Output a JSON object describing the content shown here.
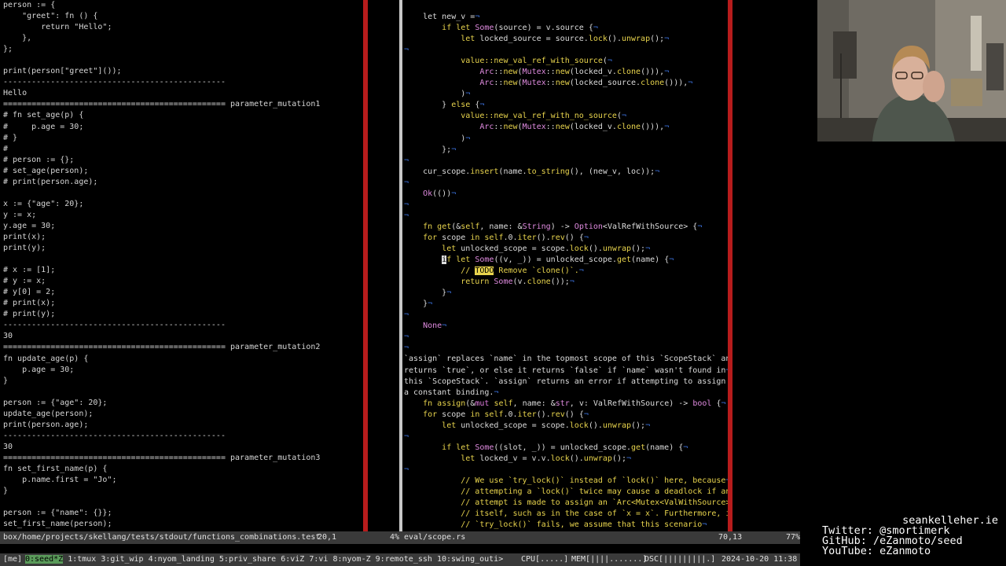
{
  "left_pane": {
    "lines": [
      "person := {",
      "    \"greet\": fn () {",
      "        return \"Hello\";",
      "    },",
      "};",
      "",
      "print(person[\"greet\"]());",
      "-----------------------------------------------",
      "Hello",
      "=============================================== parameter_mutation1",
      "# fn set_age(p) {",
      "#     p.age = 30;",
      "# }",
      "#",
      "# person := {};",
      "# set_age(person);",
      "# print(person.age);",
      "",
      "x := {\"age\": 20};",
      "y := x;",
      "y.age = 30;",
      "print(x);",
      "print(y);",
      "",
      "# x := [1];",
      "# y := x;",
      "# y[0] = 2;",
      "# print(x);",
      "# print(y);",
      "-----------------------------------------------",
      "30",
      "=============================================== parameter_mutation2",
      "fn update_age(p) {",
      "    p.age = 30;",
      "}",
      "",
      "person := {\"age\": 20};",
      "update_age(person);",
      "print(person.age);",
      "-----------------------------------------------",
      "30",
      "=============================================== parameter_mutation3",
      "fn set_first_name(p) {",
      "    p.name.first = \"Jo\";",
      "}",
      "",
      "person := {\"name\": {}};",
      "set_first_name(person);"
    ]
  },
  "right_pane": {
    "eol": "¬",
    "todo": "TODO",
    "cursor_char": "i",
    "segments": [
      [
        [
          "    let new_v =",
          ""
        ]
      ],
      [
        [
          "        ",
          ""
        ],
        [
          "if let",
          "kw"
        ],
        [
          " ",
          ""
        ],
        [
          "Some",
          "ty"
        ],
        [
          "(source) = v.source {",
          ""
        ]
      ],
      [
        [
          "            ",
          ""
        ],
        [
          "let",
          "kw"
        ],
        [
          " locked_source = source.",
          ""
        ],
        [
          "lock",
          "fnc"
        ],
        [
          "().",
          ""
        ],
        [
          "unwrap",
          "fnc"
        ],
        [
          "();",
          ""
        ]
      ],
      [
        [
          "",
          ""
        ]
      ],
      [
        [
          "            ",
          ""
        ],
        [
          "value::",
          "fnc"
        ],
        [
          "new_val_ref_with_source",
          "fnc"
        ],
        [
          "(",
          ""
        ]
      ],
      [
        [
          "                ",
          ""
        ],
        [
          "Arc",
          "ty"
        ],
        [
          "::",
          ""
        ],
        [
          "new",
          "fnc"
        ],
        [
          "(",
          ""
        ],
        [
          "Mutex",
          "ty"
        ],
        [
          "::",
          ""
        ],
        [
          "new",
          "fnc"
        ],
        [
          "(locked_v.",
          ""
        ],
        [
          "clone",
          "fnc"
        ],
        [
          "())),",
          ""
        ]
      ],
      [
        [
          "                ",
          ""
        ],
        [
          "Arc",
          "ty"
        ],
        [
          "::",
          ""
        ],
        [
          "new",
          "fnc"
        ],
        [
          "(",
          ""
        ],
        [
          "Mutex",
          "ty"
        ],
        [
          "::",
          ""
        ],
        [
          "new",
          "fnc"
        ],
        [
          "(locked_source.",
          ""
        ],
        [
          "clone",
          "fnc"
        ],
        [
          "())),",
          ""
        ]
      ],
      [
        [
          "            )",
          ""
        ]
      ],
      [
        [
          "        } ",
          ""
        ],
        [
          "else",
          "kw"
        ],
        [
          " {",
          ""
        ]
      ],
      [
        [
          "            ",
          ""
        ],
        [
          "value::",
          "fnc"
        ],
        [
          "new_val_ref_with_no_source",
          "fnc"
        ],
        [
          "(",
          ""
        ]
      ],
      [
        [
          "                ",
          ""
        ],
        [
          "Arc",
          "ty"
        ],
        [
          "::",
          ""
        ],
        [
          "new",
          "fnc"
        ],
        [
          "(",
          ""
        ],
        [
          "Mutex",
          "ty"
        ],
        [
          "::",
          ""
        ],
        [
          "new",
          "fnc"
        ],
        [
          "(locked_v.",
          ""
        ],
        [
          "clone",
          "fnc"
        ],
        [
          "())),",
          ""
        ]
      ],
      [
        [
          "            )",
          ""
        ]
      ],
      [
        [
          "        };",
          ""
        ]
      ],
      [
        [
          "",
          ""
        ]
      ],
      [
        [
          "    cur_scope.",
          ""
        ],
        [
          "insert",
          "fnc"
        ],
        [
          "(name.",
          ""
        ],
        [
          "to_string",
          "fnc"
        ],
        [
          "(), (new_v, loc));",
          ""
        ]
      ],
      [
        [
          "",
          ""
        ]
      ],
      [
        [
          "    ",
          ""
        ],
        [
          "Ok",
          "ty"
        ],
        [
          "(())",
          ""
        ]
      ],
      [
        [
          "",
          ""
        ]
      ],
      [
        [
          "",
          ""
        ]
      ],
      [
        [
          "    ",
          ""
        ],
        [
          "fn",
          "kw"
        ],
        [
          " ",
          ""
        ],
        [
          "get",
          "fnc"
        ],
        [
          "(&",
          ""
        ],
        [
          "self",
          "kw"
        ],
        [
          ", name: &",
          ""
        ],
        [
          "String",
          "ty"
        ],
        [
          ") -> ",
          ""
        ],
        [
          "Option",
          "ty"
        ],
        [
          "<ValRefWithSource> {",
          ""
        ]
      ],
      [
        [
          "    ",
          ""
        ],
        [
          "for",
          "kw"
        ],
        [
          " scope ",
          ""
        ],
        [
          "in",
          "kw"
        ],
        [
          " ",
          ""
        ],
        [
          "self",
          "kw"
        ],
        [
          ".0.",
          ""
        ],
        [
          "iter",
          "fnc"
        ],
        [
          "().",
          ""
        ],
        [
          "rev",
          "fnc"
        ],
        [
          "() {",
          ""
        ]
      ],
      [
        [
          "        ",
          ""
        ],
        [
          "let",
          "kw"
        ],
        [
          " unlocked_scope = scope.",
          ""
        ],
        [
          "lock",
          "fnc"
        ],
        [
          "().",
          ""
        ],
        [
          "unwrap",
          "fnc"
        ],
        [
          "();",
          ""
        ]
      ],
      [
        [
          "        ",
          ""
        ],
        [
          "@cursor",
          "cursor"
        ],
        [
          "f let",
          "kw"
        ],
        [
          " ",
          ""
        ],
        [
          "Some",
          "ty"
        ],
        [
          "((v, _)) = unlocked_scope.",
          ""
        ],
        [
          "get",
          "fnc"
        ],
        [
          "(name) {",
          ""
        ]
      ],
      [
        [
          "            ",
          ""
        ],
        [
          "// ",
          "cmt"
        ],
        [
          "@todo",
          "todo"
        ],
        [
          " Remove `",
          "cmt"
        ],
        [
          "clone",
          "cmt"
        ],
        [
          "()`.",
          "cmt"
        ]
      ],
      [
        [
          "            ",
          ""
        ],
        [
          "return",
          "kw"
        ],
        [
          " ",
          ""
        ],
        [
          "Some",
          "ty"
        ],
        [
          "(v.",
          ""
        ],
        [
          "clone",
          "fnc"
        ],
        [
          "());",
          ""
        ]
      ],
      [
        [
          "        }",
          ""
        ]
      ],
      [
        [
          "    }",
          ""
        ]
      ],
      [
        [
          "",
          ""
        ]
      ],
      [
        [
          "    None",
          "ty"
        ]
      ],
      [
        [
          "",
          ""
        ]
      ],
      [
        [
          "",
          ""
        ]
      ],
      [
        [
          "`assign` replaces `name` in the topmost scope of this `ScopeStack` and",
          "doc"
        ]
      ],
      [
        [
          "returns `true`, or else it returns `false` if `name` wasn't found in",
          "doc"
        ]
      ],
      [
        [
          "this `ScopeStack`. `assign` returns an error if attempting to assign to",
          "doc"
        ]
      ],
      [
        [
          "a constant binding.",
          "doc"
        ]
      ],
      [
        [
          "    ",
          ""
        ],
        [
          "fn",
          "kw"
        ],
        [
          " ",
          ""
        ],
        [
          "assign",
          "fnc"
        ],
        [
          "(&",
          ""
        ],
        [
          "mut",
          "mut"
        ],
        [
          " ",
          ""
        ],
        [
          "self",
          "kw"
        ],
        [
          ", name: &",
          ""
        ],
        [
          "str",
          "ty"
        ],
        [
          ", v: ValRefWithSource) -> ",
          ""
        ],
        [
          "bool",
          "ty"
        ],
        [
          " {",
          ""
        ]
      ],
      [
        [
          "    ",
          ""
        ],
        [
          "for",
          "kw"
        ],
        [
          " scope ",
          ""
        ],
        [
          "in",
          "kw"
        ],
        [
          " ",
          ""
        ],
        [
          "self",
          "kw"
        ],
        [
          ".0.",
          ""
        ],
        [
          "iter",
          "fnc"
        ],
        [
          "().",
          ""
        ],
        [
          "rev",
          "fnc"
        ],
        [
          "() {",
          ""
        ]
      ],
      [
        [
          "        ",
          ""
        ],
        [
          "let",
          "kw"
        ],
        [
          " unlocked_scope = scope.",
          ""
        ],
        [
          "lock",
          "fnc"
        ],
        [
          "().",
          ""
        ],
        [
          "unwrap",
          "fnc"
        ],
        [
          "();",
          ""
        ]
      ],
      [
        [
          "",
          ""
        ]
      ],
      [
        [
          "        ",
          ""
        ],
        [
          "if let",
          "kw"
        ],
        [
          " ",
          ""
        ],
        [
          "Some",
          "ty"
        ],
        [
          "((slot, _)) = unlocked_scope.",
          ""
        ],
        [
          "get",
          "fnc"
        ],
        [
          "(name) {",
          ""
        ]
      ],
      [
        [
          "            ",
          ""
        ],
        [
          "let",
          "kw"
        ],
        [
          " locked_v = v.v.",
          ""
        ],
        [
          "lock",
          "fnc"
        ],
        [
          "().",
          ""
        ],
        [
          "unwrap",
          "fnc"
        ],
        [
          "();",
          ""
        ]
      ],
      [
        [
          "",
          ""
        ]
      ],
      [
        [
          "            // We use `try_lock()` instead of `lock()` here, because",
          "cmt"
        ]
      ],
      [
        [
          "            // attempting a `lock()` twice may cause a deadlock if an",
          "cmt"
        ]
      ],
      [
        [
          "            // attempt is made to assign an `Arc<Mutex<ValWithSource>>` to",
          "cmt"
        ]
      ],
      [
        [
          "            // itself, such as in the case of `x = x`. Furthermore, if the",
          "cmt"
        ]
      ],
      [
        [
          "            // `try_lock()` fails, we assume that this scenario",
          "cmt"
        ]
      ]
    ]
  },
  "status": {
    "left_file": "box/home/projects/skellang/tests/stdout/functions_combinations.test",
    "left_pos": "20,1",
    "left_pct": "4%",
    "right_file": "eval/scope.rs",
    "right_pos": "70,13",
    "right_pct": "77%"
  },
  "tmux": {
    "session": "[me]",
    "windows": [
      "0:seed*Z",
      "1:tmux",
      "3:git_wip",
      "4:nyom_landing",
      "5:priv_share",
      "6:viZ",
      "7:vi",
      "8:nyom-Z",
      "9:remote_ssh",
      "10:swing_outi>"
    ],
    "active_window": 0,
    "cpu": "CPU[.....]",
    "mem": "MEM[||||.......]",
    "dsc": "DSC[|||||||||.]",
    "datetime": "2024-10-20 11:38"
  },
  "socials": {
    "website": "seankelleher.ie",
    "twitter": "Twitter: @smortimerk",
    "github": "GitHub: /eZanmoto/seed",
    "youtube": "YouTube: eZanmoto"
  },
  "colors": {
    "column_marker": "#b71c1c",
    "status_bg": "#3a3a3a",
    "tmux_active": "#5a9b5a",
    "keyword": "#e8d44d",
    "type": "#e08be0",
    "eol_marker": "#3a6fd8"
  }
}
